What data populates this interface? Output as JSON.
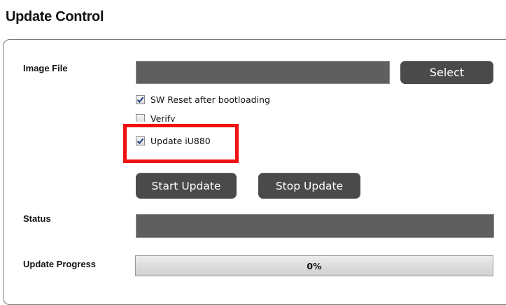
{
  "section": {
    "title": "Update Control"
  },
  "image_file": {
    "label": "Image File",
    "value": "",
    "select_label": "Select"
  },
  "options": [
    {
      "label": "SW Reset after bootloading",
      "checked": true
    },
    {
      "label": "Verify",
      "checked": false
    },
    {
      "label": "Update iU880",
      "checked": true
    }
  ],
  "actions": {
    "start_label": "Start Update",
    "stop_label": "Stop Update"
  },
  "status": {
    "label": "Status",
    "value": ""
  },
  "progress": {
    "label": "Update Progress",
    "value_fraction": 0,
    "text": "0%"
  },
  "colors": {
    "highlight": "#ee1111",
    "checkmark": "#1c3f8a",
    "button_bg": "#4a4a4a",
    "field_bg": "#5f5f5f"
  },
  "icons": {
    "checkbox_checked": "checkmark-icon"
  }
}
